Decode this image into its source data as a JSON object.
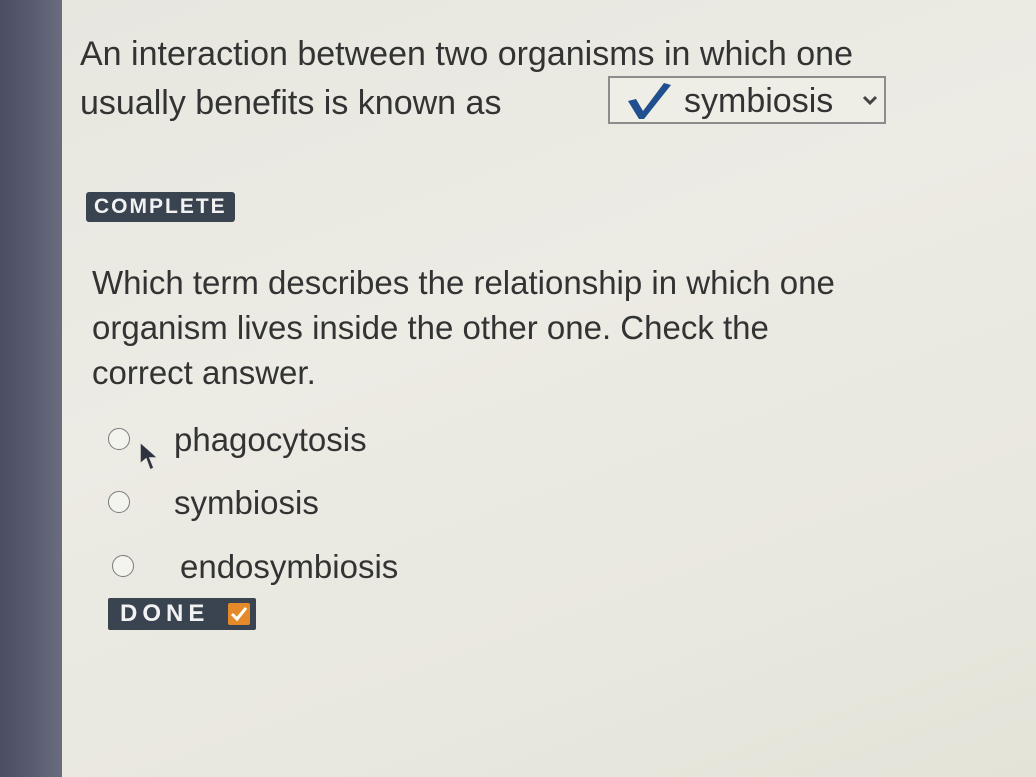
{
  "question1": {
    "text": "An interaction between two organisms in which one usually benefits is known as",
    "dropdown": {
      "selected_value": "symbiosis",
      "state_icon": "checkmark-icon",
      "caret_icon": "chevron-down-icon"
    }
  },
  "status_badge": {
    "label": "COMPLETE"
  },
  "question2": {
    "text": "Which term describes the relationship in which one organism lives inside the other one. Check the correct answer.",
    "options": [
      {
        "label": "phagocytosis",
        "selected": false
      },
      {
        "label": "symbiosis",
        "selected": false
      },
      {
        "label": "endosymbiosis",
        "selected": false
      }
    ]
  },
  "done_badge": {
    "label": "DONE",
    "icon": "checkmark-icon"
  },
  "colors": {
    "badge_bg": "#3a4350",
    "check_blue": "#1f4f8e",
    "done_accent": "#e58a2a",
    "text": "#333333"
  }
}
